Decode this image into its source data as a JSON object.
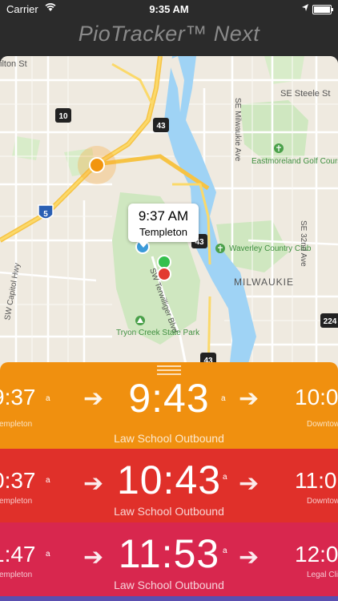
{
  "status": {
    "carrier": "Carrier",
    "time": "9:35 AM"
  },
  "app": {
    "title": "PioTracker™ Next"
  },
  "map": {
    "labels": {
      "street_top": "ilton St",
      "se_steele": "SE Steele St",
      "milwaukie_ave": "SE Milwaukie Ave",
      "eastmoreland": "Eastmoreland Golf Course",
      "capitol_hwy": "SW Capitol Hwy",
      "waverley": "Waverley Country Club",
      "se32nd": "SE 32nd Ave",
      "milwaukie": "MILWAUKIE",
      "terwilliger": "SW Terwilliger Blvd",
      "tryon": "Tryon Creek State Park",
      "shield_10": "10",
      "shield_43a": "43",
      "shield_43b": "43",
      "shield_43c": "43",
      "shield_5": "5",
      "shield_224": "224"
    },
    "callout": {
      "time": "9:37 AM",
      "stop": "Templeton"
    }
  },
  "cards": [
    {
      "color": "#f0900f",
      "prev_time": "9:37",
      "prev_ampm": "a",
      "prev_label": "Templeton",
      "main_time": "9:43",
      "main_ampm": "a",
      "next_time": "10:0",
      "next_label": "Downtow",
      "route": "Law School Outbound"
    },
    {
      "color": "#e0302a",
      "prev_time": "0:37",
      "prev_ampm": "a",
      "prev_label": "Templeton",
      "main_time": "10:43",
      "main_ampm": "a",
      "next_time": "11:0",
      "next_label": "Downtow",
      "route": "Law School Outbound"
    },
    {
      "color": "#d8274e",
      "prev_time": "1:47",
      "prev_ampm": "a",
      "prev_label": "Templeton",
      "main_time": "11:53",
      "main_ampm": "a",
      "next_time": "12:0",
      "next_label": "Legal Clin",
      "route": "Law School Outbound"
    }
  ]
}
